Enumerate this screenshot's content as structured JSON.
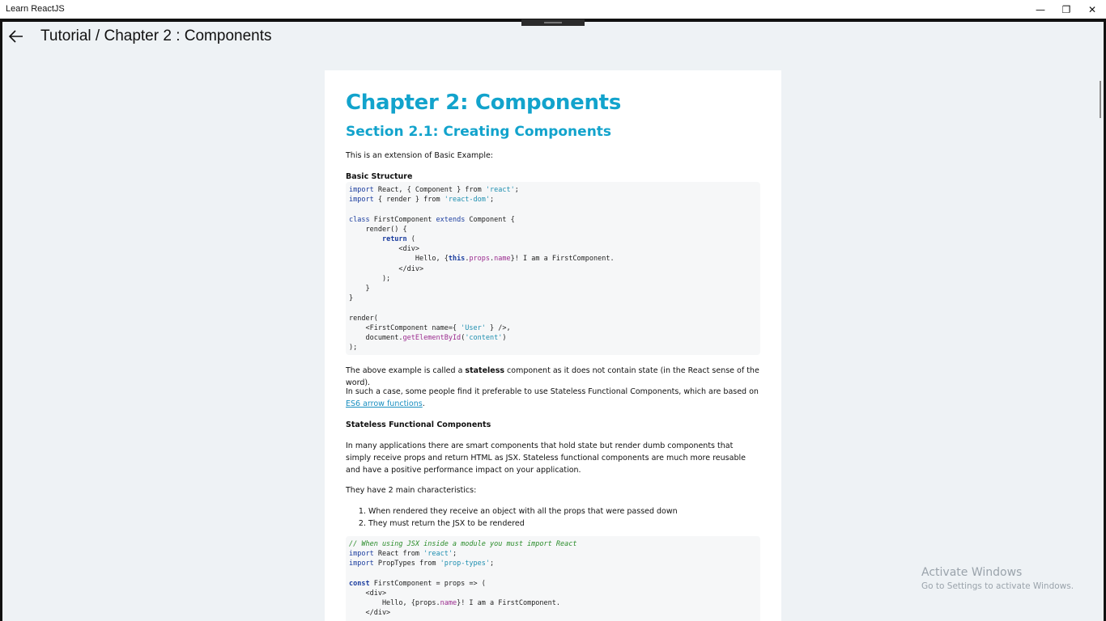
{
  "window": {
    "title": "Learn ReactJS",
    "minimize_glyph": "—",
    "restore_glyph": "❐",
    "close_glyph": "✕"
  },
  "header": {
    "title": "Tutorial / Chapter 2 :  Components",
    "back_icon": "back-arrow-icon"
  },
  "article": {
    "chapter_title": "Chapter 2: Components",
    "section_title": "Section 2.1: Creating Components",
    "intro": "This is an extension of Basic Example:",
    "basic_structure_heading": "Basic Structure",
    "stateless_para_before": "The above example is called a ",
    "stateless_para_bold": "stateless",
    "stateless_para_after": " component as it does not contain state (in the React sense of the word).",
    "such_case_before": "In such a case, some people find it preferable to use Stateless Functional Components, which are based on ",
    "such_case_link": "ES6 arrow functions",
    "such_case_after": ".",
    "sfc_heading": "Stateless Functional Components",
    "sfc_para": "In many applications there are smart components that hold state but render dumb components that simply receive props and return HTML as JSX. Stateless functional components are much more reusable and have a positive performance impact on your application.",
    "characteristics_intro": "They have 2 main characteristics:",
    "characteristics": [
      "When rendered they receive an object with all the props that were passed down",
      "They must return the JSX to be rendered"
    ]
  },
  "watermark": {
    "line1": "Activate Windows",
    "line2": "Go to Settings to activate Windows."
  }
}
